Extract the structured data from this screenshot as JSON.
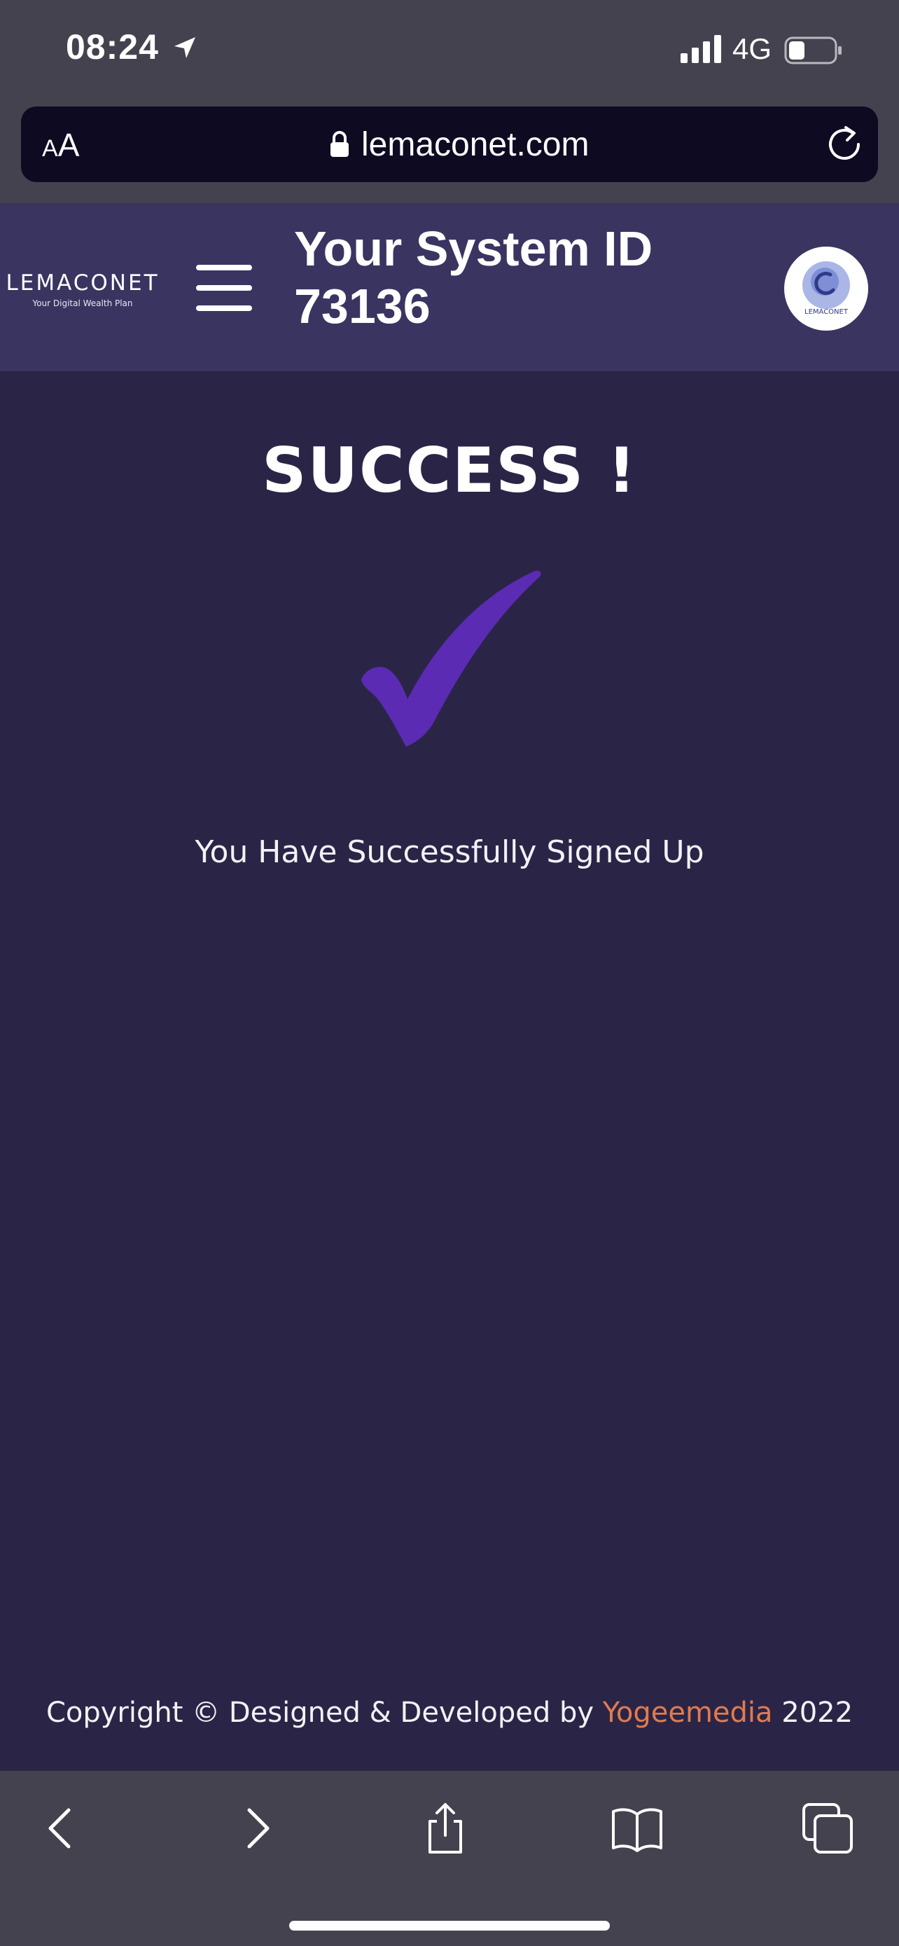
{
  "status_bar": {
    "time": "08:24",
    "network": "4G",
    "icons": [
      "location-arrow-icon",
      "cellular-signal-icon",
      "battery-icon"
    ]
  },
  "browser": {
    "text_size_label_small": "A",
    "text_size_label_large": "A",
    "url": "lemaconet.com",
    "icons": [
      "lock-icon",
      "reload-icon"
    ]
  },
  "header": {
    "brand_name": "LEMACONET",
    "brand_tagline": "Your Digital Wealth Plan",
    "system_id_label": "Your System ID",
    "system_id_value": "73136",
    "avatar_text": "LEMACONET"
  },
  "main": {
    "title": "SUCCESS !",
    "message": "You Have Successfully Signed Up",
    "check_color": "#5b2bb4"
  },
  "footer": {
    "prefix": "Copyright © Designed & Developed by",
    "brand": "Yogeemedia",
    "year": "2022",
    "brand_color": "#e07b4f"
  },
  "toolbar": {
    "icons": [
      "back-icon",
      "forward-icon",
      "share-icon",
      "bookmarks-icon",
      "tabs-icon"
    ]
  },
  "colors": {
    "background": "#2a2547",
    "header": "#3a3461",
    "chrome": "#45424f"
  }
}
